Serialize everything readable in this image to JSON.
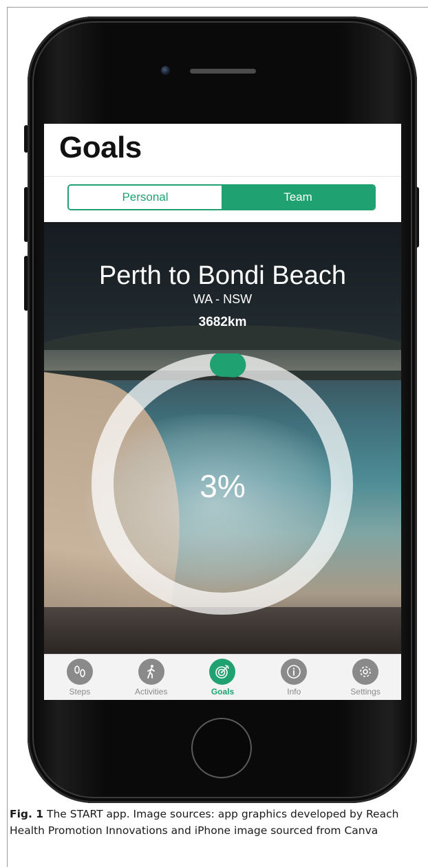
{
  "screen": {
    "title": "Goals",
    "segments": [
      "Personal",
      "Team"
    ],
    "selected_segment": "Team",
    "route": {
      "title": "Perth to Bondi Beach",
      "states": "WA - NSW",
      "distance": "3682km"
    },
    "progress": {
      "percent_label": "3%",
      "value": 0.03
    },
    "tabs": [
      {
        "label": "Steps",
        "icon": "footprints-icon"
      },
      {
        "label": "Activities",
        "icon": "walking-person-icon"
      },
      {
        "label": "Goals",
        "icon": "target-icon",
        "active": true
      },
      {
        "label": "Info",
        "icon": "info-icon"
      },
      {
        "label": "Settings",
        "icon": "gear-icon"
      }
    ]
  },
  "caption": {
    "label": "Fig. 1",
    "text": "The START app. Image sources: app graphics developed by Reach Health Promotion Innovations and iPhone image sourced from Canva"
  },
  "colors": {
    "accent": "#1fa171",
    "tab_inactive": "#8a8a8a"
  }
}
